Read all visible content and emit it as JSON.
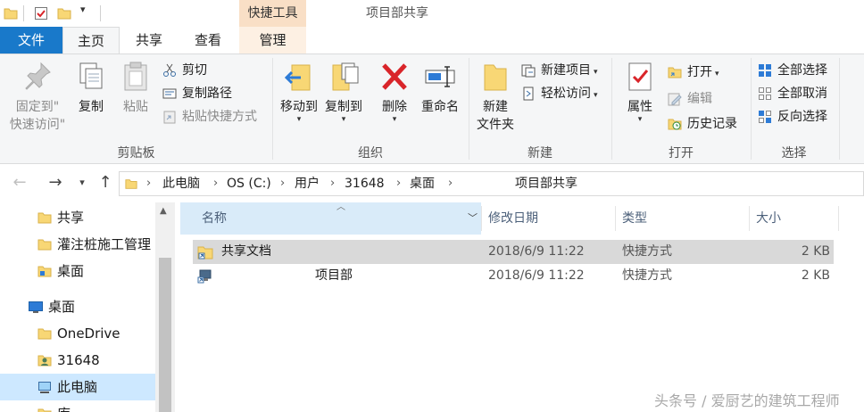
{
  "titlebar": {
    "context_tab_header": "快捷工具",
    "window_title": "项目部共享"
  },
  "tabs": {
    "file": "文件",
    "home": "主页",
    "share": "共享",
    "view": "查看",
    "manage": "管理"
  },
  "ribbon": {
    "clipboard": {
      "group_label": "剪贴板",
      "pin_line1": "固定到\"",
      "pin_line2": "快速访问\"",
      "copy": "复制",
      "paste": "粘贴",
      "cut": "剪切",
      "copy_path": "复制路径",
      "paste_shortcut": "粘贴快捷方式"
    },
    "organize": {
      "group_label": "组织",
      "move_to": "移动到",
      "copy_to": "复制到",
      "delete": "删除",
      "rename": "重命名"
    },
    "new": {
      "group_label": "新建",
      "new_folder_line1": "新建",
      "new_folder_line2": "文件夹",
      "new_item": "新建项目",
      "easy_access": "轻松访问"
    },
    "open": {
      "group_label": "打开",
      "properties": "属性",
      "open": "打开",
      "edit": "编辑",
      "history": "历史记录"
    },
    "select": {
      "group_label": "选择",
      "select_all": "全部选择",
      "select_none": "全部取消",
      "invert": "反向选择"
    }
  },
  "address": {
    "crumbs": [
      "此电脑",
      "OS (C:)",
      "用户",
      "31648",
      "桌面",
      "",
      "项目部共享"
    ]
  },
  "navpane": {
    "items": [
      {
        "label": "共享",
        "icon": "folder-icon"
      },
      {
        "label": "灌注桩施工管理",
        "icon": "folder-icon"
      },
      {
        "label": "桌面",
        "icon": "folder-icon"
      },
      {
        "label": "桌面",
        "icon": "desktop-icon"
      },
      {
        "label": "OneDrive",
        "icon": "folder-icon"
      },
      {
        "label": "31648",
        "icon": "user-icon"
      },
      {
        "label": "此电脑",
        "icon": "computer-icon"
      },
      {
        "label": "库",
        "icon": "folder-icon"
      }
    ]
  },
  "columns": {
    "name": "名称",
    "date": "修改日期",
    "type": "类型",
    "size": "大小"
  },
  "files": [
    {
      "name": "共享文档",
      "date": "2018/6/9 11:22",
      "type": "快捷方式",
      "size": "2 KB",
      "selected": true
    },
    {
      "name": "项目部",
      "date": "2018/6/9 11:22",
      "type": "快捷方式",
      "size": "2 KB",
      "selected": false
    }
  ],
  "watermark": "头条号 / 爱厨艺的建筑工程师",
  "colors": {
    "file_tab": "#1979ca",
    "context_tab": "#f9dfc6",
    "selection": "#cde8ff",
    "folder": "#f8d775",
    "delete_red": "#d9252a"
  }
}
